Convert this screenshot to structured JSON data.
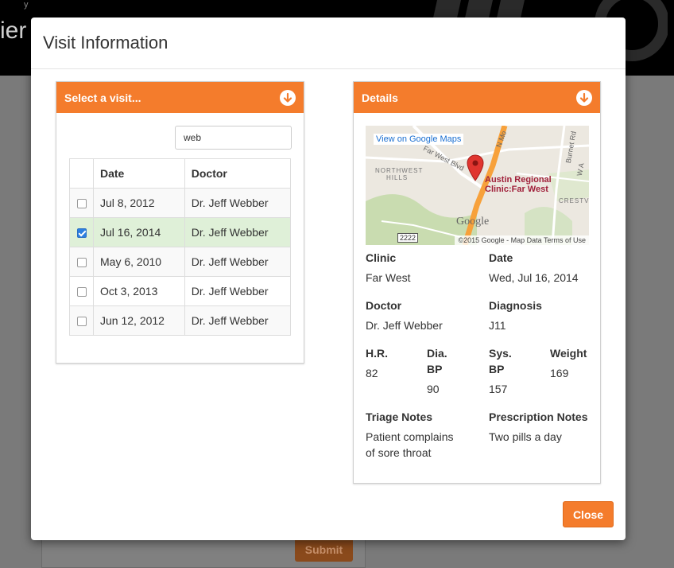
{
  "background": {
    "header_text": "ier",
    "top_text": "y",
    "submit_label": "Submit"
  },
  "modal": {
    "title": "Visit Information",
    "close_label": "Close"
  },
  "visits_panel": {
    "heading": "Select a visit...",
    "search_value": "web",
    "columns": [
      "Date",
      "Doctor"
    ],
    "rows": [
      {
        "date": "Jul 8, 2012",
        "doctor": "Dr. Jeff Webber",
        "checked": false
      },
      {
        "date": "Jul 16, 2014",
        "doctor": "Dr. Jeff Webber",
        "checked": true
      },
      {
        "date": "May 6, 2010",
        "doctor": "Dr. Jeff Webber",
        "checked": false
      },
      {
        "date": "Oct 3, 2013",
        "doctor": "Dr. Jeff Webber",
        "checked": false
      },
      {
        "date": "Jun 12, 2012",
        "doctor": "Dr. Jeff Webber",
        "checked": false
      }
    ]
  },
  "details_panel": {
    "heading": "Details",
    "map": {
      "link_text": "View on Google Maps",
      "marker_label_line1": "Austin Regional",
      "marker_label_line2": "Clinic:Far West",
      "area_label_1_line1": "NORTHWEST",
      "area_label_1_line2": "HILLS",
      "area_label_2": "CRESTV",
      "street_1": "Far West Blvd",
      "street_2": "N Mo",
      "street_3": "Burnet Rd",
      "street_4": "W A",
      "road_sign": "2222",
      "google_logo": "Google",
      "footer": "©2015 Google - Map Data   Terms of Use"
    },
    "clinic_label": "Clinic",
    "clinic_value": "Far West",
    "date_label": "Date",
    "date_value": "Wed, Jul 16, 2014",
    "doctor_label": "Doctor",
    "doctor_value": "Dr. Jeff Webber",
    "diagnosis_label": "Diagnosis",
    "diagnosis_value": "J11",
    "hr_label": "H.R.",
    "hr_value": "82",
    "dia_label_line1": "Dia.",
    "dia_label_line2": "BP",
    "dia_value": "90",
    "sys_label_line1": "Sys.",
    "sys_label_line2": "BP",
    "sys_value": "157",
    "weight_label": "Weight",
    "weight_value": "169",
    "triage_label": "Triage Notes",
    "triage_value_line1": "Patient complains",
    "triage_value_line2": "of sore throat",
    "prescription_label": "Prescription Notes",
    "prescription_value": "Two pills a day"
  },
  "colors": {
    "accent": "#f47c2c",
    "selected_row": "#dff0d8",
    "checkbox_checked": "#2d7fe0"
  }
}
